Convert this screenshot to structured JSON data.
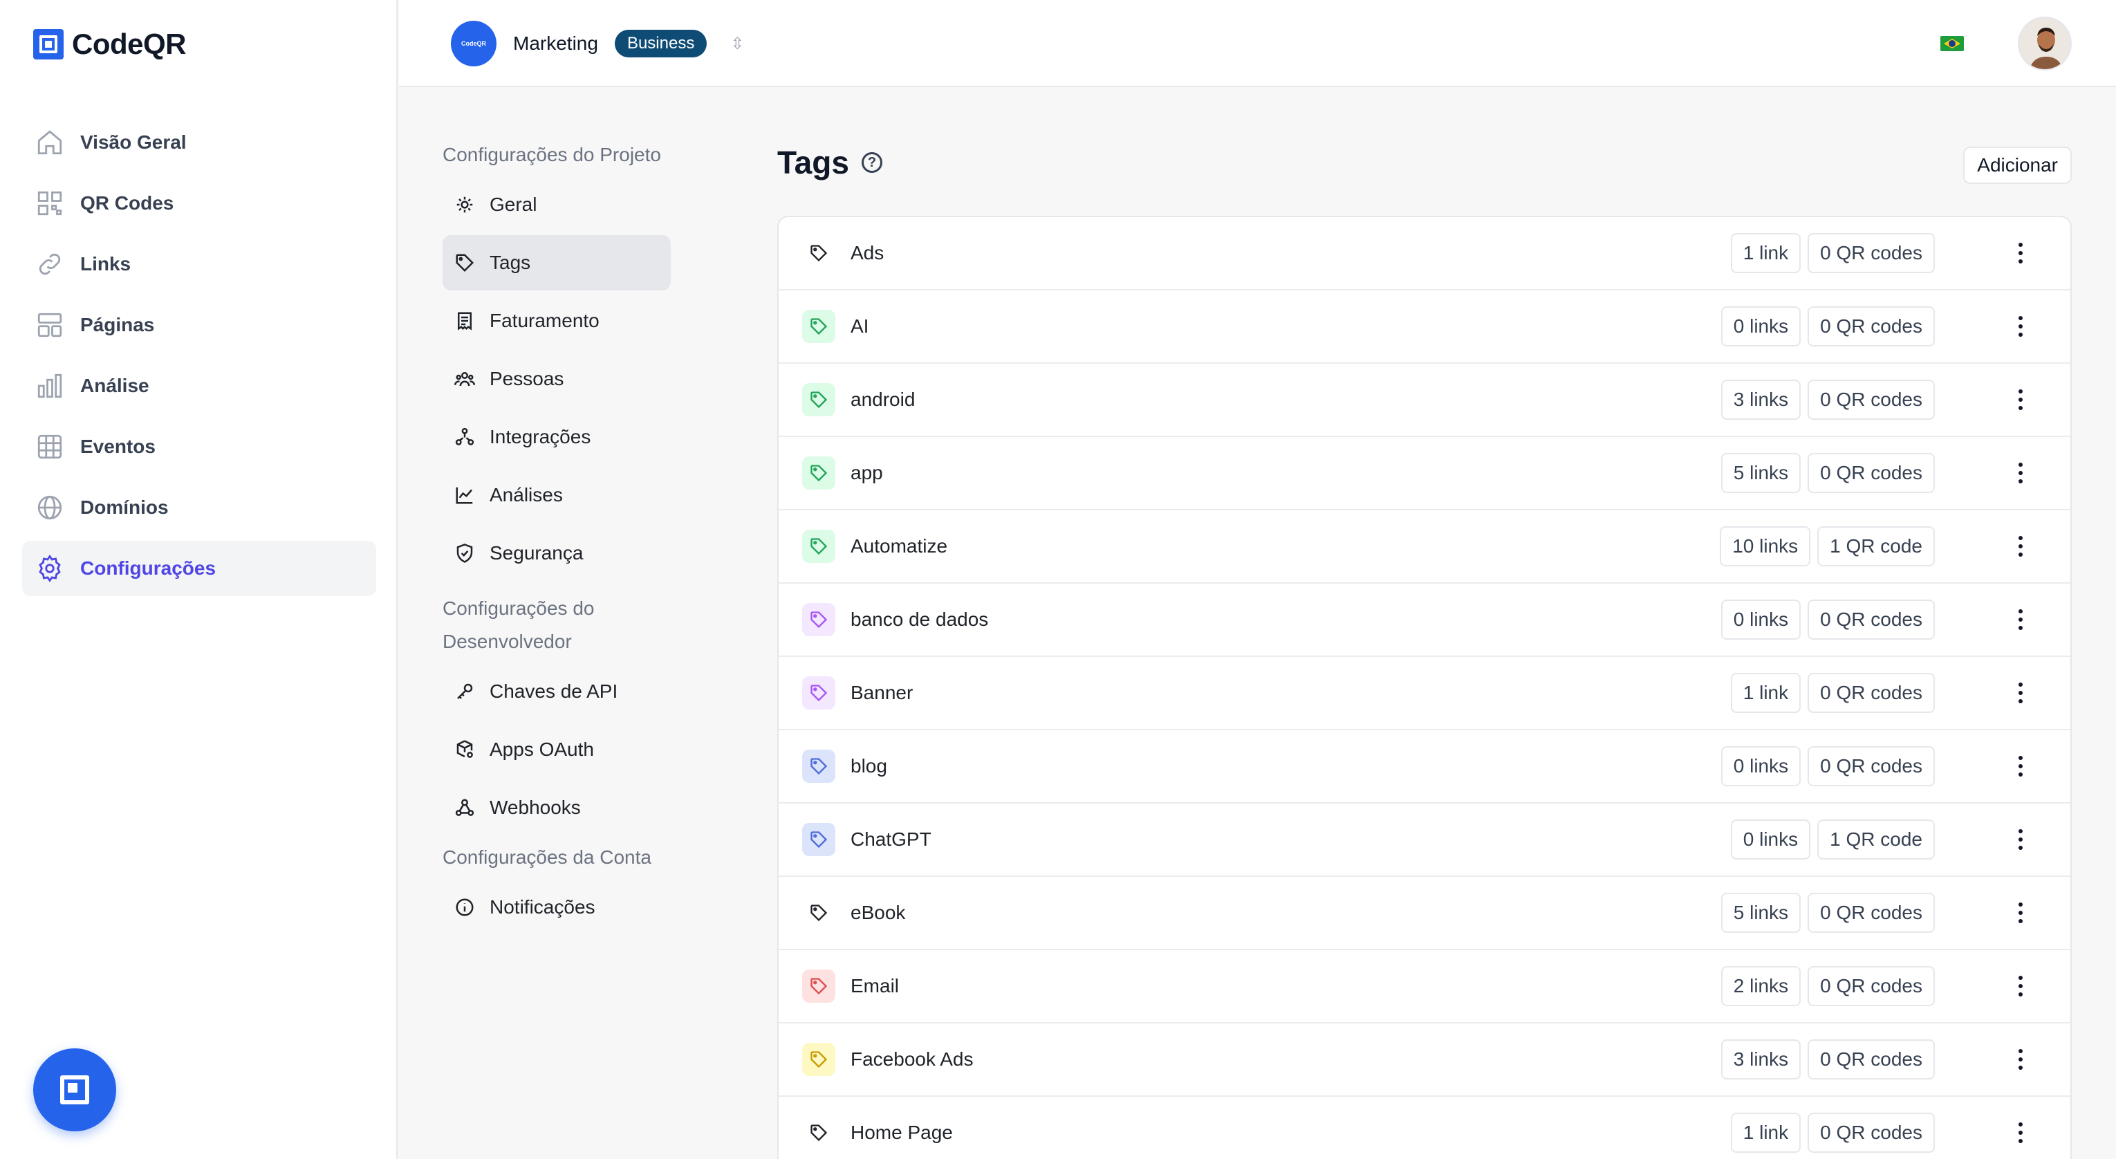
{
  "app": {
    "name": "CodeQR"
  },
  "sidebar": {
    "items": [
      {
        "label": "Visão Geral",
        "icon": "home-icon",
        "active": false
      },
      {
        "label": "QR Codes",
        "icon": "qr-code-icon",
        "active": false
      },
      {
        "label": "Links",
        "icon": "link-icon",
        "active": false
      },
      {
        "label": "Páginas",
        "icon": "pages-layout-icon",
        "active": false
      },
      {
        "label": "Análise",
        "icon": "bar-chart-icon",
        "active": false
      },
      {
        "label": "Eventos",
        "icon": "grid-table-icon",
        "active": false
      },
      {
        "label": "Domínios",
        "icon": "globe-icon",
        "active": false
      },
      {
        "label": "Configurações",
        "icon": "gear-icon",
        "active": true
      }
    ],
    "active_color": "#4f46e5"
  },
  "topbar": {
    "project_name": "Marketing",
    "plan": "Business",
    "project_avatar_text": "CodeQR",
    "language_flag": "brazil-flag-icon"
  },
  "settings_nav": {
    "project_section": "Configurações do Projeto",
    "project_items": [
      {
        "label": "Geral",
        "icon": "cog-icon",
        "active": false
      },
      {
        "label": "Tags",
        "icon": "tag-icon",
        "active": true
      },
      {
        "label": "Faturamento",
        "icon": "receipt-icon",
        "active": false
      },
      {
        "label": "Pessoas",
        "icon": "users-icon",
        "active": false
      },
      {
        "label": "Integrações",
        "icon": "integrations-icon",
        "active": false
      },
      {
        "label": "Análises",
        "icon": "line-chart-icon",
        "active": false
      },
      {
        "label": "Segurança",
        "icon": "shield-check-icon",
        "active": false
      }
    ],
    "developer_section": "Configurações do Desenvolvedor",
    "developer_items": [
      {
        "label": "Chaves de API",
        "icon": "key-icon",
        "active": false
      },
      {
        "label": "Apps OAuth",
        "icon": "box-cog-icon",
        "active": false
      },
      {
        "label": "Webhooks",
        "icon": "webhook-icon",
        "active": false
      }
    ],
    "account_section": "Configurações da Conta",
    "account_items": [
      {
        "label": "Notificações",
        "icon": "info-circle-icon",
        "active": false
      }
    ]
  },
  "tags_page": {
    "title": "Tags",
    "help": "?",
    "add_button": "Adicionar",
    "tags": [
      {
        "name": "Ads",
        "links": "1 link",
        "qr": "0 QR codes",
        "color": "none"
      },
      {
        "name": "AI",
        "links": "0 links",
        "qr": "0 QR codes",
        "color": "#dcfce7"
      },
      {
        "name": "android",
        "links": "3 links",
        "qr": "0 QR codes",
        "color": "#dcfce7"
      },
      {
        "name": "app",
        "links": "5 links",
        "qr": "0 QR codes",
        "color": "#dcfce7"
      },
      {
        "name": "Automatize",
        "links": "10 links",
        "qr": "1 QR code",
        "color": "#dcfce7"
      },
      {
        "name": "banco de dados",
        "links": "0 links",
        "qr": "0 QR codes",
        "color": "#f3e8ff"
      },
      {
        "name": "Banner",
        "links": "1 link",
        "qr": "0 QR codes",
        "color": "#f3e8ff"
      },
      {
        "name": "blog",
        "links": "0 links",
        "qr": "0 QR codes",
        "color": "#dbe4fb"
      },
      {
        "name": "ChatGPT",
        "links": "0 links",
        "qr": "1 QR code",
        "color": "#dbe4fb"
      },
      {
        "name": "eBook",
        "links": "5 links",
        "qr": "0 QR codes",
        "color": "none"
      },
      {
        "name": "Email",
        "links": "2 links",
        "qr": "0 QR codes",
        "color": "#fee2e2"
      },
      {
        "name": "Facebook Ads",
        "links": "3 links",
        "qr": "0 QR codes",
        "color": "#fef9c3"
      },
      {
        "name": "Home Page",
        "links": "1 link",
        "qr": "0 QR codes",
        "color": "none"
      }
    ]
  }
}
